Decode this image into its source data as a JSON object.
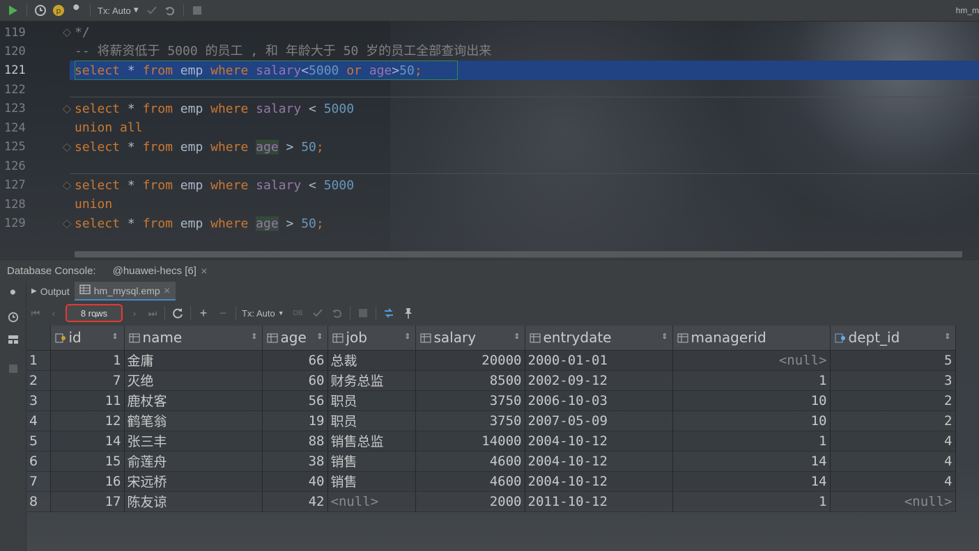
{
  "toolbar": {
    "tx_mode": "Tx: Auto",
    "file_title": "hm_m"
  },
  "editor": {
    "line_numbers": [
      "119",
      "120",
      "121",
      "122",
      "123",
      "124",
      "125",
      "126",
      "127",
      "128",
      "129"
    ],
    "comment_end": "*/",
    "comment": "-- 将薪资低于 5000 的员工 , 和 年龄大于 50 岁的员工全部查询出来",
    "tokens": {
      "select": "select",
      "star": "*",
      "from": "from",
      "table": "emp",
      "where": "where",
      "salary": "salary",
      "age": "age",
      "or": "or",
      "union": "union",
      "union_all": "union all",
      "lt": "<",
      "gt": ">",
      "v5000": "5000",
      "v50": "50",
      "semi": ";"
    }
  },
  "console": {
    "title": "Database Console:",
    "session": "@huawei-hecs [6]",
    "tabs": [
      "Output",
      "hm_mysql.emp"
    ],
    "rows_label": "8 rows",
    "tx_mode": "Tx: Auto"
  },
  "grid": {
    "columns": [
      "id",
      "name",
      "age",
      "job",
      "salary",
      "entrydate",
      "managerid",
      "dept_id"
    ],
    "rows": [
      {
        "n": "1",
        "id": "1",
        "name": "金庸",
        "age": "66",
        "job": "总裁",
        "salary": "20000",
        "entrydate": "2000-01-01",
        "managerid": "<null>",
        "dept_id": "5"
      },
      {
        "n": "2",
        "id": "7",
        "name": "灭绝",
        "age": "60",
        "job": "财务总监",
        "salary": "8500",
        "entrydate": "2002-09-12",
        "managerid": "1",
        "dept_id": "3"
      },
      {
        "n": "3",
        "id": "11",
        "name": "鹿杖客",
        "age": "56",
        "job": "职员",
        "salary": "3750",
        "entrydate": "2006-10-03",
        "managerid": "10",
        "dept_id": "2"
      },
      {
        "n": "4",
        "id": "12",
        "name": "鹤笔翁",
        "age": "19",
        "job": "职员",
        "salary": "3750",
        "entrydate": "2007-05-09",
        "managerid": "10",
        "dept_id": "2"
      },
      {
        "n": "5",
        "id": "14",
        "name": "张三丰",
        "age": "88",
        "job": "销售总监",
        "salary": "14000",
        "entrydate": "2004-10-12",
        "managerid": "1",
        "dept_id": "4"
      },
      {
        "n": "6",
        "id": "15",
        "name": "俞莲舟",
        "age": "38",
        "job": "销售",
        "salary": "4600",
        "entrydate": "2004-10-12",
        "managerid": "14",
        "dept_id": "4"
      },
      {
        "n": "7",
        "id": "16",
        "name": "宋远桥",
        "age": "40",
        "job": "销售",
        "salary": "4600",
        "entrydate": "2004-10-12",
        "managerid": "14",
        "dept_id": "4"
      },
      {
        "n": "8",
        "id": "17",
        "name": "陈友谅",
        "age": "42",
        "job": "<null>",
        "salary": "2000",
        "entrydate": "2011-10-12",
        "managerid": "1",
        "dept_id": "<null>"
      }
    ]
  },
  "colors": {
    "keyword": "#cc7832",
    "number": "#6897bb",
    "column": "#9876aa",
    "comment": "#808080",
    "selection": "#214283",
    "rows_badge_border": "#e53935",
    "run_green": "#4caf50"
  },
  "icons": [
    "run-icon",
    "history-icon",
    "profile-icon",
    "settings-wrench-icon",
    "commit-icon",
    "rollback-icon",
    "stop-icon",
    "refresh-icon",
    "add-row-icon",
    "delete-row-icon",
    "pin-icon"
  ]
}
